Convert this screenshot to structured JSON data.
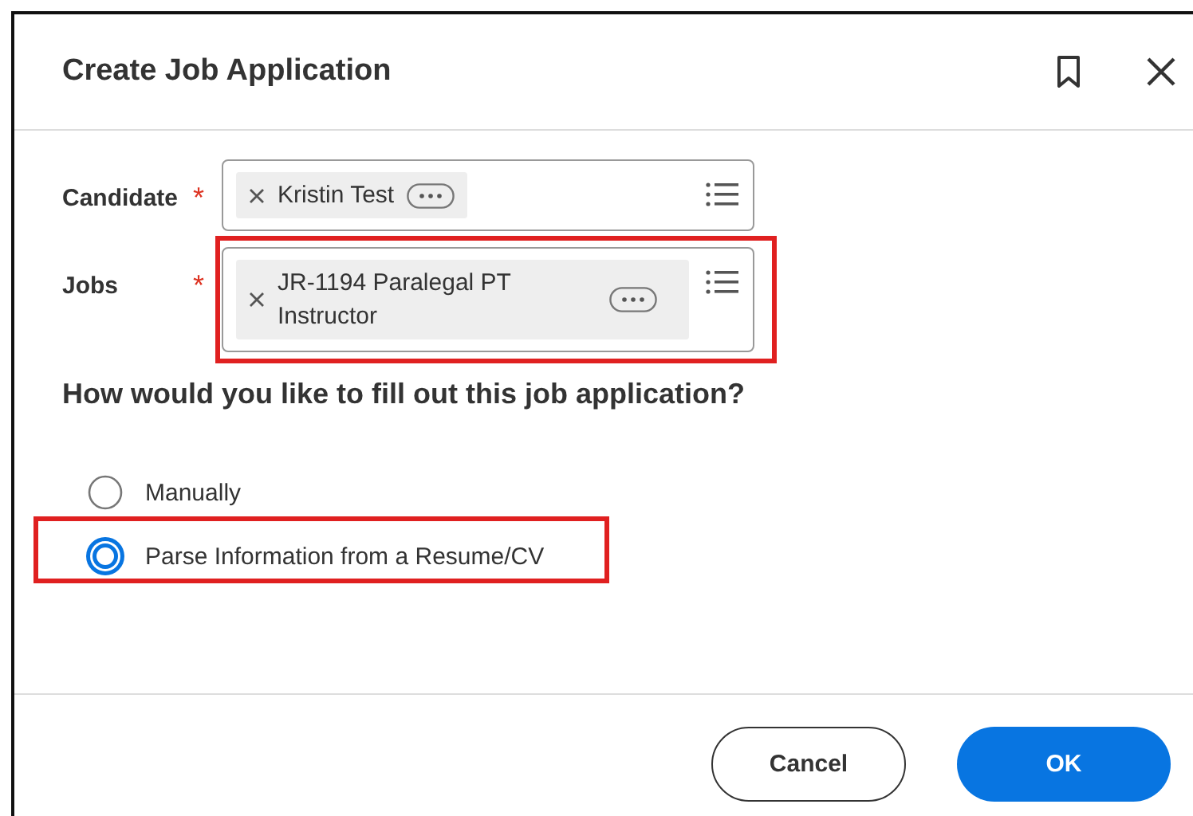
{
  "dialog": {
    "title": "Create Job Application"
  },
  "fields": [
    {
      "label": "Candidate",
      "required_mark": "*",
      "highlighted": false,
      "value": "Kristin Test"
    },
    {
      "label": "Jobs",
      "required_mark": "*",
      "highlighted": true,
      "value": "JR-1194 Paralegal PT Instructor"
    }
  ],
  "question": "How would you like to fill out this job application?",
  "options": [
    {
      "label": "Manually",
      "selected": false,
      "highlighted": false
    },
    {
      "label": "Parse Information from a Resume/CV",
      "selected": true,
      "highlighted": true
    }
  ],
  "buttons": [
    {
      "label": "Cancel",
      "kind": "secondary"
    },
    {
      "label": "OK",
      "kind": "primary"
    }
  ]
}
